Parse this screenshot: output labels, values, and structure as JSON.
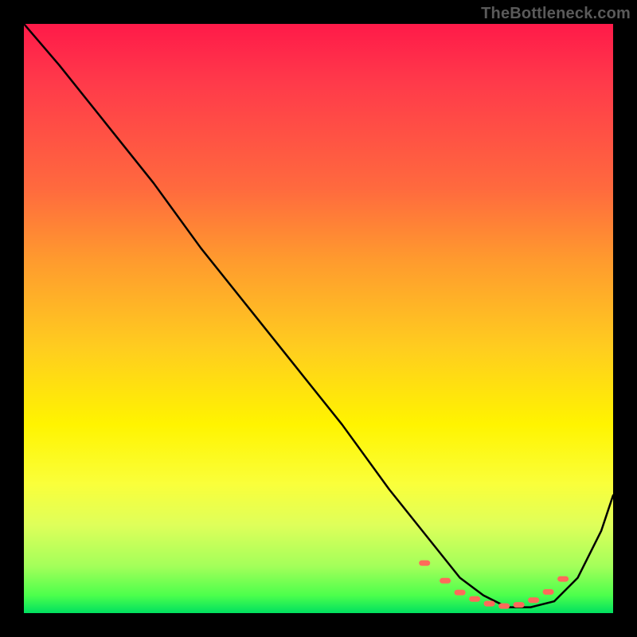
{
  "watermark": "TheBottleneck.com",
  "chart_data": {
    "type": "line",
    "title": "",
    "xlabel": "",
    "ylabel": "",
    "xlim": [
      0,
      100
    ],
    "ylim": [
      0,
      100
    ],
    "grid": false,
    "legend": null,
    "background_gradient": {
      "top": "#ff1a49",
      "mid_high": "#ff9a2e",
      "mid": "#fff400",
      "mid_low": "#a4ff5a",
      "bottom": "#00e060"
    },
    "series": [
      {
        "name": "bottleneck-curve",
        "color": "#000000",
        "x": [
          0,
          6,
          14,
          22,
          30,
          38,
          46,
          54,
          62,
          66,
          70,
          74,
          78,
          82,
          86,
          90,
          94,
          98,
          100
        ],
        "y": [
          100,
          93,
          83,
          73,
          62,
          52,
          42,
          32,
          21,
          16,
          11,
          6,
          3,
          1,
          1,
          2,
          6,
          14,
          20
        ]
      }
    ],
    "markers": {
      "name": "optimal-range-markers",
      "color": "#ff6a5a",
      "shape": "rounded-rect",
      "x": [
        68,
        71.5,
        74,
        76.5,
        79,
        81.5,
        84,
        86.5,
        89,
        91.5
      ],
      "y": [
        8.5,
        5.5,
        3.5,
        2.4,
        1.6,
        1.2,
        1.4,
        2.2,
        3.6,
        5.8
      ]
    }
  }
}
